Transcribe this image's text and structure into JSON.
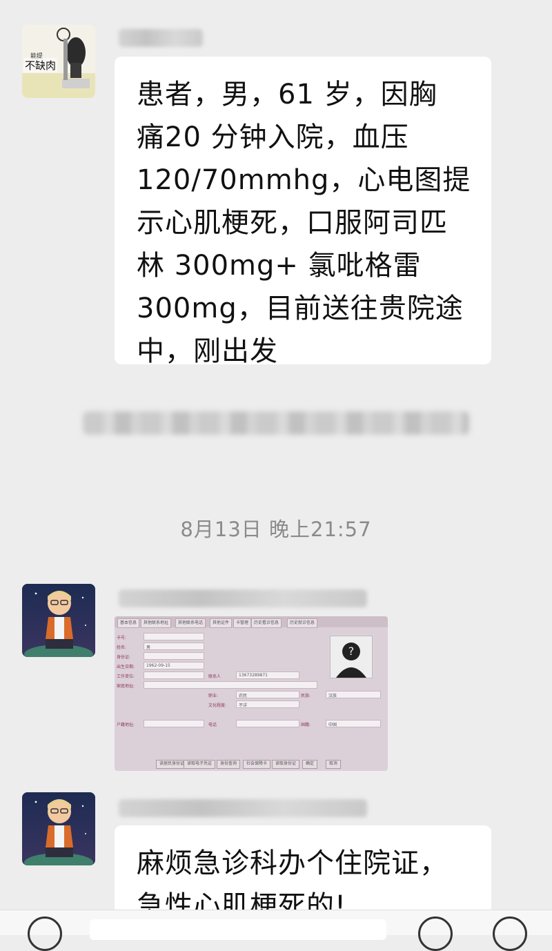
{
  "messages": [
    {
      "sender": "",
      "avatar_text": "不缺肉",
      "avatar_small_text": "能提",
      "lines": [
        "患者，男，61 岁，因胸",
        "痛20 分钟入院，血压",
        "120/70mmhg，心电图提",
        "示心肌梗死，口服阿司匹",
        "林 300mg+ 氯吡格雷",
        "300mg，目前送往贵院途",
        "中，刚出发"
      ]
    },
    {
      "sender": "",
      "type": "image"
    },
    {
      "sender": "",
      "lines": [
        "麻烦急诊科办个住院证，",
        "急性心肌梗死的!"
      ]
    }
  ],
  "system_notice": "",
  "timestamp": "8月13日 晚上21:57",
  "screenshot_form": {
    "tabs": [
      "基本信息",
      "其他联系地址",
      "其他联系电话",
      "其他证件",
      "卡管理",
      "历史看诊信息",
      "历史就诊信息"
    ],
    "labels": [
      "卡号:",
      "姓名:",
      "身份证:",
      "出生日期:",
      "工作单位:",
      "家庭地址:",
      "户籍地址:",
      "联系人",
      "电话",
      "职业:",
      "文化程度:",
      "民族:",
      "国籍:"
    ],
    "values": [
      "男",
      "1962-09-15",
      "13673289871",
      "汉族",
      "不详",
      "农民",
      "中国"
    ],
    "buttons": [
      "读居民身份证",
      "读取电子凭证",
      "身份查询",
      "社会保障卡",
      "读取身份证",
      "确定",
      "取消"
    ]
  },
  "colors": {
    "background": "#ededed",
    "bubble": "#ffffff",
    "timestamp": "#8a8a8a"
  }
}
